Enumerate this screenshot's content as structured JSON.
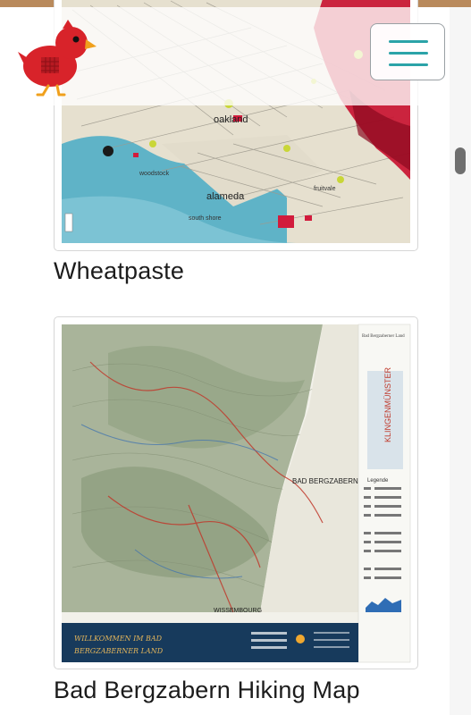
{
  "cards": [
    {
      "title": "Wheatpaste",
      "map_labels": [
        "oakland",
        "alameda",
        "woodstock",
        "south shore",
        "fruitvale"
      ]
    },
    {
      "title": "Bad Bergzabern Hiking Map",
      "map_labels": [
        "BAD BERGZABERN",
        "KLINGENMÜNSTER",
        "WISSEMBOURG",
        "Legende",
        "Bad Bergzaberner Land"
      ],
      "banner_lines": [
        "WILLKOMMEN IM BAD",
        "BERGZABERNER LAND"
      ]
    }
  ],
  "header": {
    "logo_icon": "red-bird-icon",
    "menu_icon": "hamburger-icon",
    "accent_color": "#2ba3a8",
    "stripe_color": "#b98a5c"
  }
}
